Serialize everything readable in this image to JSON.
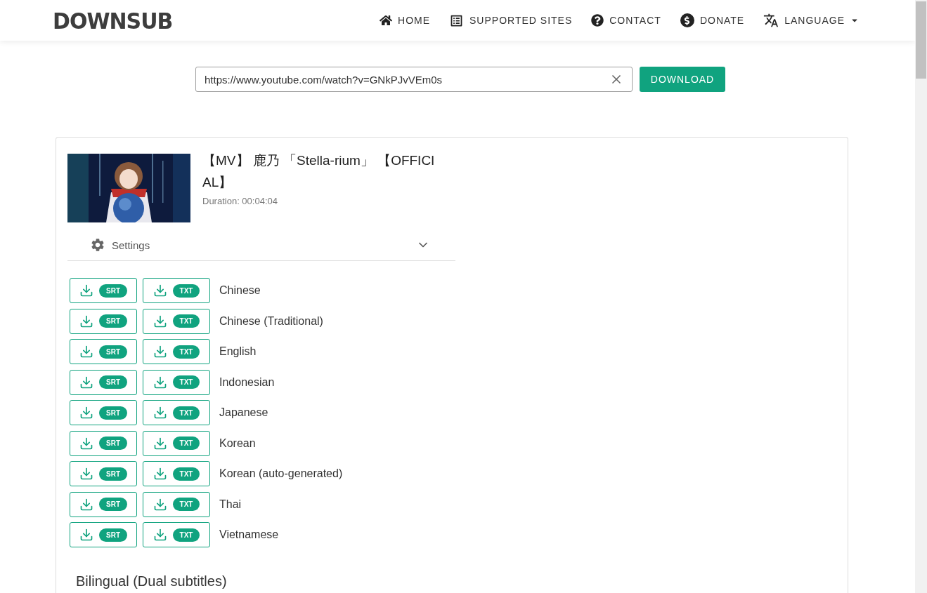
{
  "header": {
    "logo": "DOWNSUB",
    "nav": [
      {
        "kind": "home",
        "label": "HOME"
      },
      {
        "kind": "list",
        "label": "SUPPORTED SITES"
      },
      {
        "kind": "help",
        "label": "CONTACT"
      },
      {
        "kind": "dollar",
        "label": "DONATE"
      },
      {
        "kind": "translate",
        "label": "LANGUAGE",
        "dropdown": true
      }
    ]
  },
  "search": {
    "value": "https://www.youtube.com/watch?v=GNkPJvVEm0s",
    "button": "DOWNLOAD"
  },
  "video": {
    "title": "【MV】 鹿乃 「Stella-rium」 【OFFICIAL】",
    "duration": "Duration: 00:04:04"
  },
  "settings": {
    "label": "Settings",
    "expanded": false
  },
  "subtitles": [
    {
      "language": "Chinese",
      "formats": [
        "SRT",
        "TXT"
      ]
    },
    {
      "language": "Chinese (Traditional)",
      "formats": [
        "SRT",
        "TXT"
      ]
    },
    {
      "language": "English",
      "formats": [
        "SRT",
        "TXT"
      ]
    },
    {
      "language": "Indonesian",
      "formats": [
        "SRT",
        "TXT"
      ]
    },
    {
      "language": "Japanese",
      "formats": [
        "SRT",
        "TXT"
      ]
    },
    {
      "language": "Korean",
      "formats": [
        "SRT",
        "TXT"
      ]
    },
    {
      "language": "Korean (auto-generated)",
      "formats": [
        "SRT",
        "TXT"
      ]
    },
    {
      "language": "Thai",
      "formats": [
        "SRT",
        "TXT"
      ]
    },
    {
      "language": "Vietnamese",
      "formats": [
        "SRT",
        "TXT"
      ]
    }
  ],
  "bilingual_heading": "Bilingual (Dual subtitles)"
}
